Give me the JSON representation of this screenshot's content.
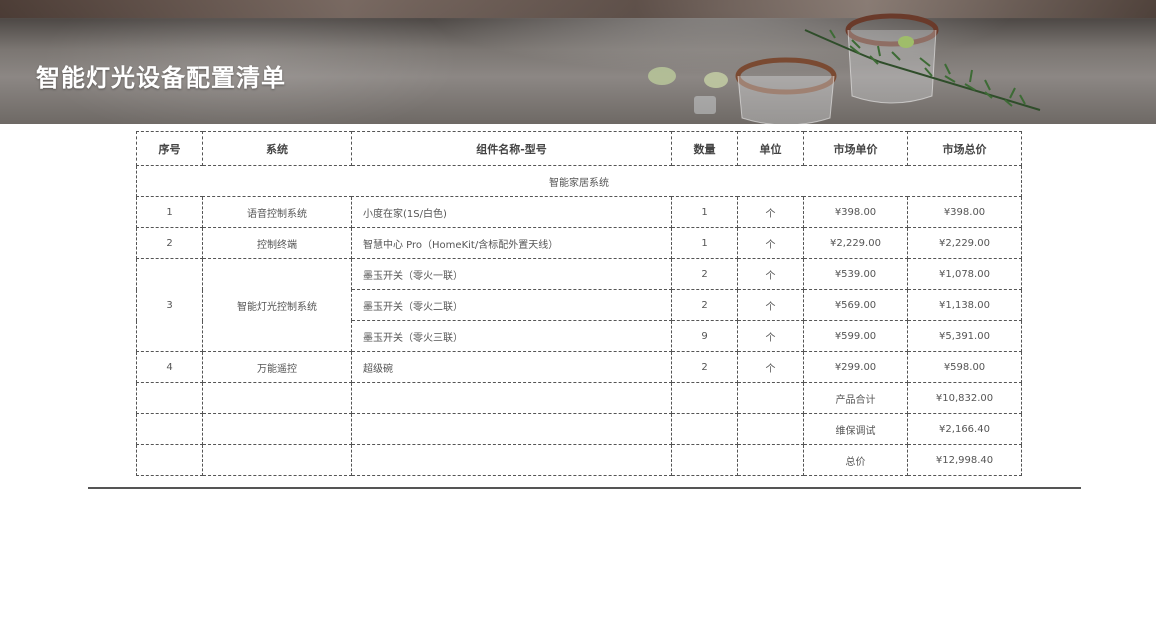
{
  "page": {
    "title": "智能灯光设备配置清单",
    "accent_color": "#555555",
    "banner_image": "marble-table-with-glasses-and-rosemary"
  },
  "table": {
    "headers": {
      "index": "序号",
      "system": "系统",
      "component": "组件名称-型号",
      "quantity": "数量",
      "unit": "单位",
      "unit_price": "市场单价",
      "total_price": "市场总价"
    },
    "section_title": "智能家居系统",
    "rows": [
      {
        "index": "1",
        "system": "语音控制系统",
        "component": "小度在家(1S/白色)",
        "quantity": "1",
        "unit": "个",
        "unit_price": "¥398.00",
        "total_price": "¥398.00"
      },
      {
        "index": "2",
        "system": "控制终端",
        "component": "智慧中心 Pro（HomeKit/含标配外置天线）",
        "quantity": "1",
        "unit": "个",
        "unit_price": "¥2,229.00",
        "total_price": "¥2,229.00"
      },
      {
        "index": "3",
        "system": "智能灯光控制系统",
        "component": "墨玉开关（零火一联）",
        "quantity": "2",
        "unit": "个",
        "unit_price": "¥539.00",
        "total_price": "¥1,078.00"
      },
      {
        "component": "墨玉开关（零火二联）",
        "quantity": "2",
        "unit": "个",
        "unit_price": "¥569.00",
        "total_price": "¥1,138.00"
      },
      {
        "component": "墨玉开关（零火三联）",
        "quantity": "9",
        "unit": "个",
        "unit_price": "¥599.00",
        "total_price": "¥5,391.00"
      },
      {
        "index": "4",
        "system": "万能遥控",
        "component": "超级碗",
        "quantity": "2",
        "unit": "个",
        "unit_price": "¥299.00",
        "total_price": "¥598.00"
      }
    ],
    "summary": [
      {
        "label": "产品合计",
        "value": "¥10,832.00"
      },
      {
        "label": "维保调试",
        "value": "¥2,166.40"
      },
      {
        "label": "总价",
        "value": "¥12,998.40"
      }
    ]
  }
}
